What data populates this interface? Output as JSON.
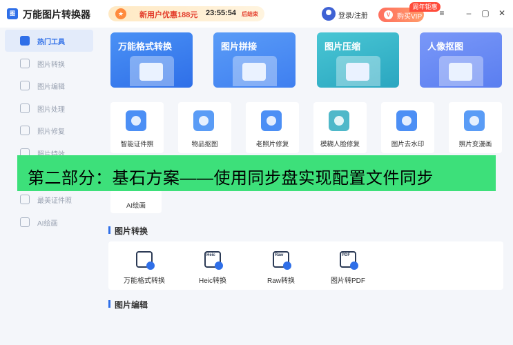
{
  "app": {
    "logo_text": "图",
    "title": "万能图片转换器"
  },
  "promo": {
    "gift_icon": "gift-icon",
    "text": "新用户优惠188元",
    "timer": "23:55:54",
    "end": "后结束"
  },
  "account": {
    "login": "登录/注册"
  },
  "vip": {
    "label": "购买VIP",
    "badge": "周年钜惠",
    "icon_text": "V"
  },
  "window": {
    "menu": "≡",
    "minimize": "–",
    "maximize": "▢",
    "close": "✕"
  },
  "sidebar": {
    "items": [
      {
        "label": "热门工具"
      },
      {
        "label": "图片转换"
      },
      {
        "label": "图片编辑"
      },
      {
        "label": "图片处理"
      },
      {
        "label": "照片修复"
      },
      {
        "label": "照片特效"
      },
      {
        "label": "最美证件照"
      },
      {
        "label": "AI绘画"
      }
    ]
  },
  "feature_cards": [
    {
      "title": "万能格式转换",
      "color": "#3f86f2"
    },
    {
      "title": "图片拼接",
      "color": "#4a8df4"
    },
    {
      "title": "图片压缩",
      "color": "#3bb6c9"
    },
    {
      "title": "人像抠图",
      "color": "#6d8ef7"
    }
  ],
  "tools": [
    {
      "label": "智能证件照",
      "color": "#4c8ff5"
    },
    {
      "label": "物品抠图",
      "color": "#5a9cf6"
    },
    {
      "label": "老照片修复",
      "color": "#4c8ff5"
    },
    {
      "label": "模糊人脸修复",
      "color": "#4fb8c9"
    },
    {
      "label": "图片去水印",
      "color": "#4c8ff5"
    },
    {
      "label": "照片变漫画",
      "color": "#5a9cf6"
    }
  ],
  "ai_tool": {
    "label": "AI绘画"
  },
  "sections": {
    "convert": "图片转换",
    "edit": "图片编辑"
  },
  "convert_items": [
    {
      "label": "万能格式转换",
      "tag": ""
    },
    {
      "label": "Heic转换",
      "tag": "Heic"
    },
    {
      "label": "Raw转换",
      "tag": "Raw"
    },
    {
      "label": "图片转PDF",
      "tag": "PDF"
    }
  ],
  "banner": {
    "text": "第二部分：基石方案——使用同步盘实现配置文件同步"
  }
}
